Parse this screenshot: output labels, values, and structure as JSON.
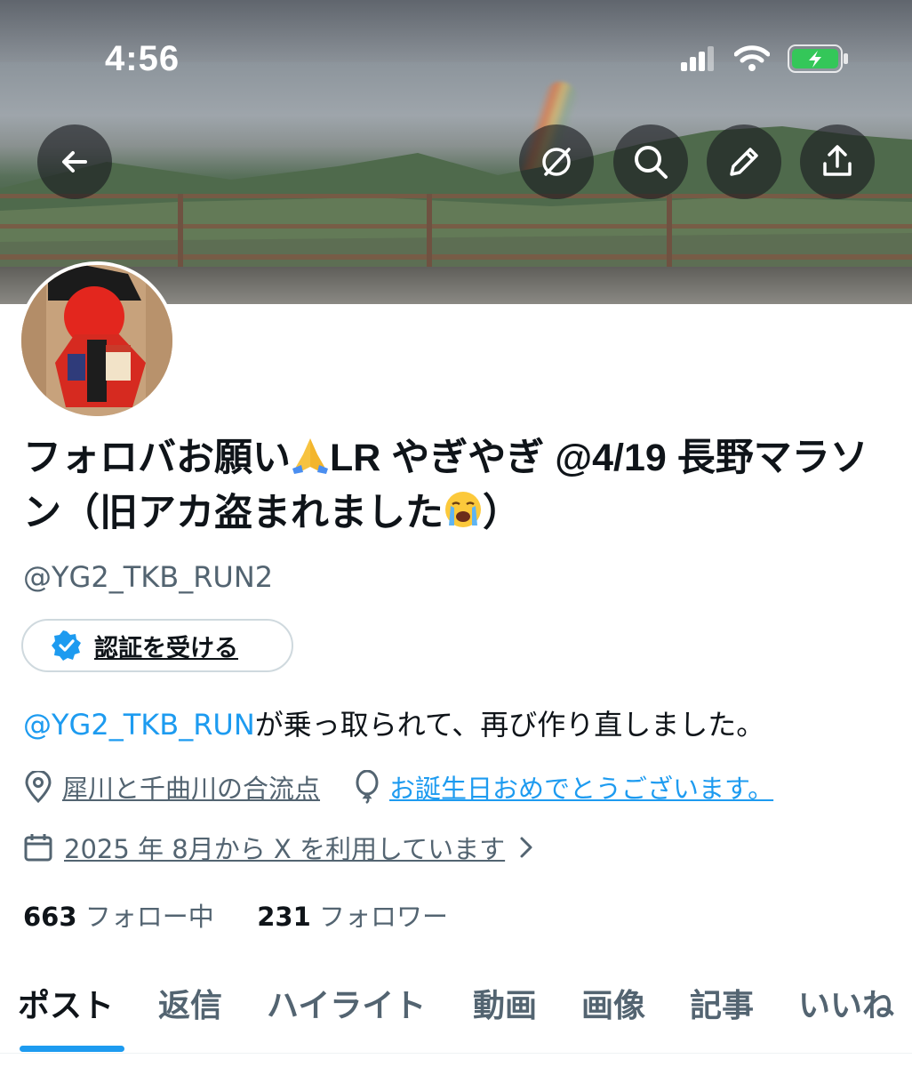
{
  "status_bar": {
    "time": "4:56",
    "battery_color": "#34c759"
  },
  "header_actions": {
    "back_icon": "arrow-left-icon",
    "actions": [
      "grok-icon",
      "search-icon",
      "edit-icon",
      "share-icon"
    ]
  },
  "profile": {
    "display_name_part1": "フォロバお願い",
    "display_name_emoji1": "folded-hands-emoji",
    "display_name_part2": "LR やぎやぎ @4/19 長野マラソン（旧アカ盗まれました",
    "display_name_emoji2": "crying-face-emoji",
    "display_name_part3": "）",
    "handle": "@YG2_TKB_RUN2",
    "verify_button_label": "認証を受ける",
    "bio_mention": "@YG2_TKB_RUN",
    "bio_text": "が乗っ取られて、再び作り直しました。",
    "location": "犀川と千曲川の合流点",
    "birthday": "お誕生日おめでとうございます。",
    "joined": "2025 年 8月から X を利用しています",
    "following_count": "663",
    "following_label": "フォロー中",
    "followers_count": "231",
    "followers_label": "フォロワー"
  },
  "tabs": [
    {
      "label": "ポスト",
      "active": true
    },
    {
      "label": "返信",
      "active": false
    },
    {
      "label": "ハイライト",
      "active": false
    },
    {
      "label": "動画",
      "active": false
    },
    {
      "label": "画像",
      "active": false
    },
    {
      "label": "記事",
      "active": false
    },
    {
      "label": "いいね",
      "active": false
    }
  ],
  "colors": {
    "accent": "#1d9bf0",
    "text": "#0f1419",
    "muted": "#536471"
  }
}
